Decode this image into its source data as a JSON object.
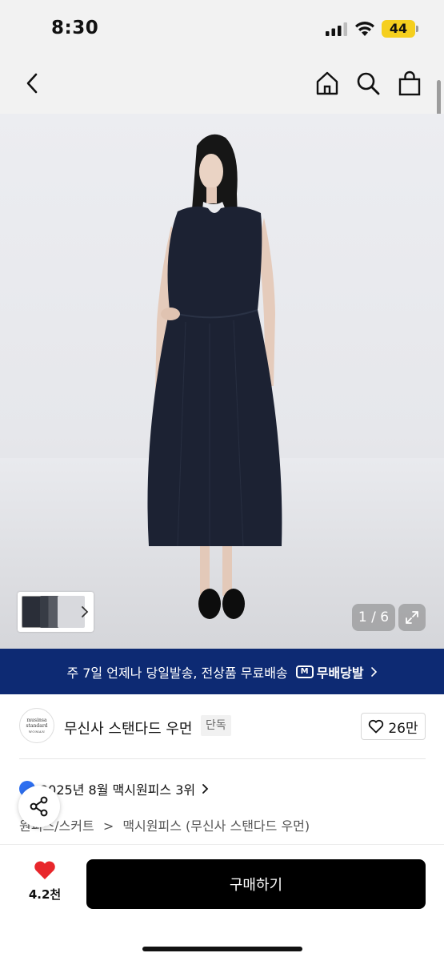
{
  "status_bar": {
    "time": "8:30",
    "battery": "44"
  },
  "gallery": {
    "page_indicator": "1 / 6",
    "current_page": 1,
    "total_pages": 6
  },
  "shipping_banner": {
    "text": "주 7일 언제나 당일발송, 전상품 무료배송",
    "badge_icon": "M",
    "badge_label": "무배당발"
  },
  "brand": {
    "name": "무신사 스탠다드 우먼",
    "exclusive_badge": "단독",
    "likes": "26만",
    "logo_lines": [
      "musinsa",
      "standard",
      "WOMAN"
    ]
  },
  "ranking": {
    "text": "2025년 8월 맥시원피스 3위"
  },
  "category": {
    "parent": "원피스/스커트",
    "separator": ">",
    "child": "맥시원피스 (무신사 스탠다드 우먼)"
  },
  "bottom_bar": {
    "wish_count": "4.2천",
    "buy_label": "구매하기"
  },
  "colors": {
    "banner": "#0d2a73",
    "buy_button": "#000000",
    "heart": "#e8262b",
    "battery": "#f5cf1e"
  }
}
